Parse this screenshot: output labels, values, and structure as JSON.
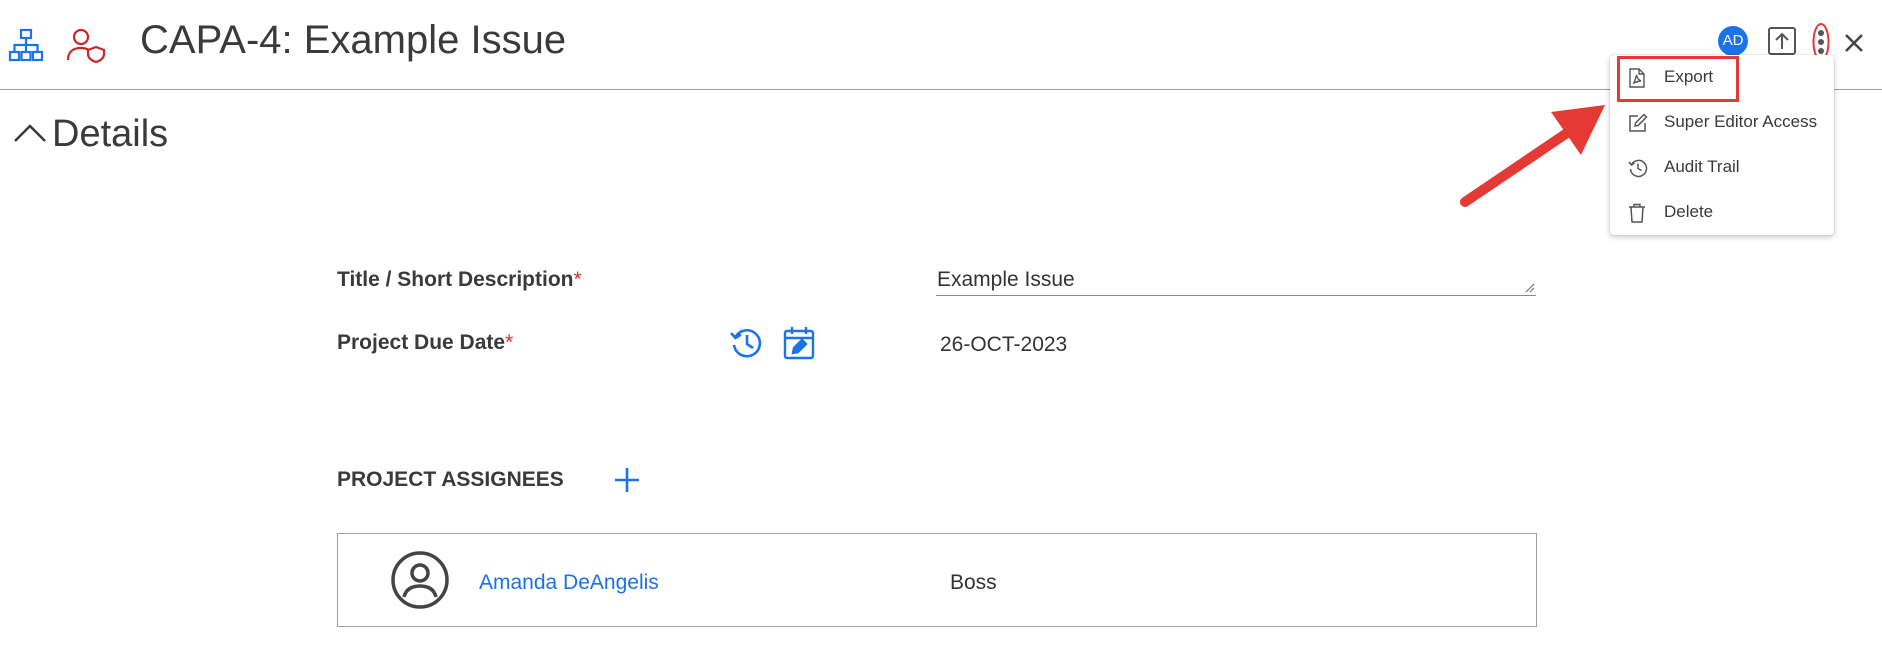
{
  "header": {
    "title": "CAPA-4: Example Issue",
    "avatar_initials": "AD",
    "icons": {
      "hierarchy": "hierarchy-icon",
      "user_shield": "user-shield-icon",
      "upload": "upload-icon",
      "more": "more-vertical-icon",
      "close": "close-icon"
    }
  },
  "section": {
    "title": "Details"
  },
  "form": {
    "title_label": "Title / Short Description",
    "title_value": "Example Issue",
    "due_date_label": "Project Due Date",
    "due_date_value": "26-OCT-2023",
    "required_mark": "*"
  },
  "assignees": {
    "heading": "PROJECT ASSIGNEES",
    "items": [
      {
        "name": "Amanda DeAngelis",
        "role": "Boss"
      }
    ]
  },
  "menu": {
    "items": [
      {
        "label": "Export",
        "icon": "pdf-file-icon"
      },
      {
        "label": "Super Editor Access",
        "icon": "edit-icon"
      },
      {
        "label": "Audit Trail",
        "icon": "history-icon"
      },
      {
        "label": "Delete",
        "icon": "trash-icon"
      }
    ]
  },
  "colors": {
    "brand_blue": "#1a73e8",
    "required_red": "#d32f2f",
    "annotation_red": "#e53935",
    "shield_red": "#c62828"
  }
}
